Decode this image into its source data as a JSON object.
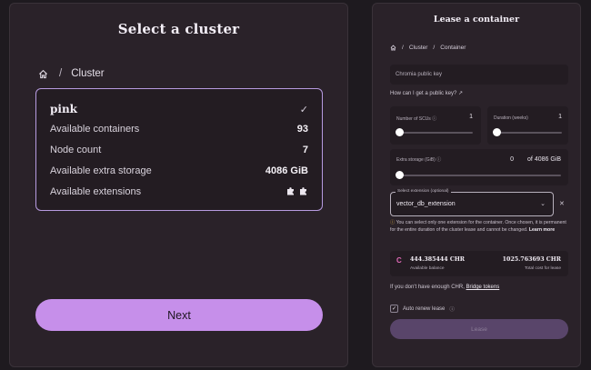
{
  "left": {
    "title": "Select a cluster",
    "breadcrumb": {
      "home_icon": "home-icon",
      "current": "Cluster"
    },
    "cluster": {
      "name": "pink",
      "selected_icon": "check-icon",
      "rows": [
        {
          "label": "Available containers",
          "value": "93"
        },
        {
          "label": "Node count",
          "value": "7"
        },
        {
          "label": "Available extra storage",
          "value": "4086 GiB"
        },
        {
          "label": "Available extensions",
          "value": ""
        }
      ],
      "extension_icons": [
        "puzzle-icon",
        "puzzle-icon"
      ]
    },
    "next_label": "Next"
  },
  "right": {
    "title": "Lease a container",
    "breadcrumb": [
      "Cluster",
      "Container"
    ],
    "public_key_placeholder": "Chromia public key",
    "public_key_help": "How can I get a public key?",
    "scu": {
      "label": "Number of SCUs",
      "value": "1"
    },
    "duration": {
      "label": "Duration (weeks)",
      "value": "1"
    },
    "storage": {
      "label": "Extra storage (GiB)",
      "value": "0",
      "max": "of 4086 GiB"
    },
    "extension": {
      "label": "Select extension (optional)",
      "value": "vector_db_extension"
    },
    "warning": "You can select only one extension for the container. Once chosen, it is permanent for the entire duration of the cluster lease and cannot be changed.",
    "learn_more": "Learn more",
    "balance": {
      "value": "444.385444 CHR",
      "label": "Available balance"
    },
    "total": {
      "value": "1025.763693 CHR",
      "label": "Total cost for lease"
    },
    "not_enough": "If you don't have enough CHR,",
    "bridge_link": "Bridge tokens",
    "auto_renew": "Auto renew lease",
    "lease_label": "Lease"
  }
}
